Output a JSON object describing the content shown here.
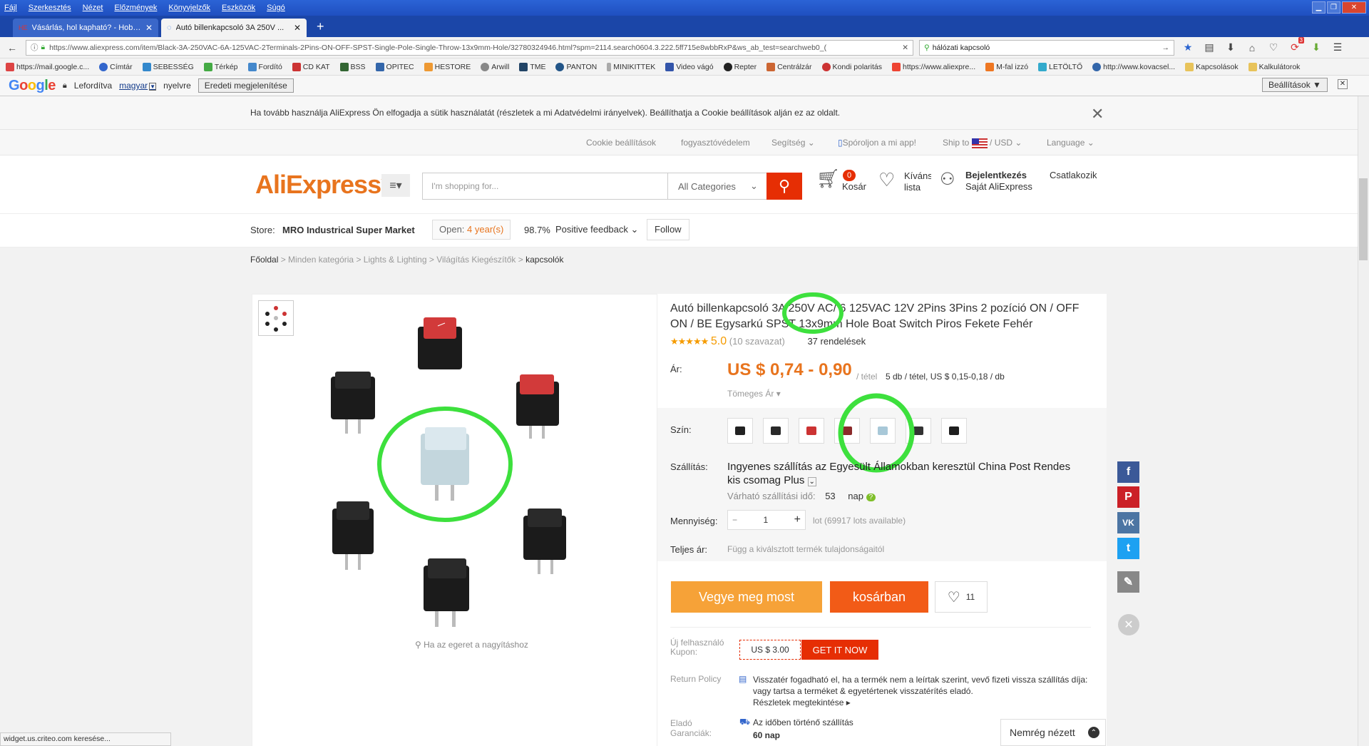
{
  "browser": {
    "menu": [
      "Fájl",
      "Szerkesztés",
      "Nézet",
      "Előzmények",
      "Könyvjelzők",
      "Eszközök",
      "Súgó"
    ],
    "tabs": [
      {
        "title": "Vásárlás, hol kapható? - Hobb..."
      },
      {
        "title": "Autó billenkapcsoló 3A 250V ..."
      }
    ],
    "url": "https://www.aliexpress.com/item/Black-3A-250VAC-6A-125VAC-2Terminals-2Pins-ON-OFF-SPST-Single-Pole-Single-Throw-13x9mm-Hole/32780324946.html?spm=2114.search0604.3.222.5ff715e8wbbRxP&ws_ab_test=searchweb0_(",
    "search_value": "hálózati kapcsoló",
    "notification_count": "3",
    "bookmarks": [
      "https://mail.google.c...",
      "Címtár",
      "SEBESSÉG",
      "Térkép",
      "Fordító",
      "CD KAT",
      "BSS",
      "OPITEC",
      "HESTORE",
      "Arwill",
      "TME",
      "PANTON",
      "MINIKITTEK",
      "Video vágó",
      "Repter",
      "Centrálzár",
      "Kondi polaritás",
      "https://www.aliexpre...",
      "M-fal izzó",
      "LETÖLTŐ",
      "http://www.kovacsel...",
      "Kapcsolások",
      "Kalkulátorok"
    ],
    "translate": {
      "logo": "Google",
      "translated": "Lefordítva",
      "language": "magyar",
      "suffix": "nyelvre",
      "show_original": "Eredeti megjelenítése",
      "settings": "Beállítások ▼"
    },
    "status": "widget.us.criteo.com keresése..."
  },
  "page": {
    "cookie_notice": "Ha tovább használja AliExpress Ön elfogadja a sütik használatát (részletek a mi Adatvédelmi irányelvek). Beállíthatja a Cookie beállítások alján ez az oldalt.",
    "topnav": {
      "cookie_settings": "Cookie beállítások",
      "consumer": "fogyasztóvédelem",
      "help": "Segítség",
      "app": "Spóroljon a mi app!",
      "ship_to": "Ship to",
      "currency": "USD",
      "language": "Language"
    },
    "header": {
      "logo": "AliExpress",
      "search_placeholder": "I'm shopping for...",
      "all_categories": "All Categories",
      "cart_count": "0",
      "cart_label": "Kosár",
      "wish_label": "Kívánság lista",
      "wish_line1": "Kívánság",
      "wish_line2": "lista",
      "login": "Bejelentkezés",
      "my_ali": "Saját AliExpress",
      "join": "Csatlakozik"
    },
    "store": {
      "label": "Store:",
      "name": "MRO Industrical Super Market",
      "open_label": "Open:",
      "open_years": "4 year(s)",
      "feedback_pct": "98.7%",
      "feedback_label": "Positive feedback",
      "follow": "Follow"
    },
    "breadcrumb": [
      "Főoldal",
      "Minden kategória",
      "Lights & Lighting",
      "Világítás Kiegészítők",
      "kapcsolók"
    ],
    "gallery": {
      "zoom_hint": "Ha az egeret a nagyításhoz"
    },
    "product": {
      "title": "Autó billenkapcsoló 3A 250V AC/ 6 125VAC 12V 2Pins 3Pins 2 pozíció ON / OFF ON / BE Egysarkú SPST 13x9mm Hole Boat Switch Piros Fekete Fehér",
      "rating": "5.0",
      "rating_value": 5.0,
      "reviews": "(10 szavazat)",
      "orders": "37 rendelések",
      "price_label": "Ár:",
      "price": "US $ 0,74 - 0,90",
      "price_unit": "/ tétel",
      "lot_info": "5 db / tétel, US $ 0,15-0,18 / db",
      "bulk": "Tömeges Ár",
      "color_label": "Szín:",
      "colors": [
        {
          "name": "black",
          "color": "#222"
        },
        {
          "name": "black",
          "color": "#2a2a2a"
        },
        {
          "name": "red",
          "color": "#cc3333"
        },
        {
          "name": "red-black",
          "color": "#8b2a2a"
        },
        {
          "name": "white",
          "color": "#a8c8d8"
        },
        {
          "name": "black",
          "color": "#333"
        },
        {
          "name": "black",
          "color": "#1e1e1e"
        }
      ],
      "shipping_label": "Szállítás:",
      "shipping_text": "Ingyenes szállítás az Egyesült Államokban keresztül China Post Rendes kis csomag Plus",
      "delivery_label": "Várható szállítási idő:",
      "delivery_days": "53",
      "delivery_unit": "nap",
      "qty_label": "Mennyiség:",
      "qty_value": "1",
      "qty_available": "lot (69917 lots available)",
      "total_label": "Teljes ár:",
      "total_text": "Függ a kiválsztott termék tulajdonságaitól",
      "buy_now": "Vegye meg most",
      "add_cart": "kosárban",
      "wish_count": "11",
      "coupon_label": "Új felhasználó Kupon:",
      "coupon_amount": "US $ 3.00",
      "coupon_btn": "GET IT NOW",
      "return_label": "Return Policy",
      "return_text": "Visszatér fogadható el, ha a termék nem a leírtak szerint, vevő fizeti vissza szállítás díja: vagy tartsa a terméket & egyetértenek visszatérítés eladó.",
      "return_more": "Részletek megtekintése",
      "guarantee_label": "Eladó Garanciák:",
      "guarantee_text": "Az időben történő szállítás",
      "guarantee_days": "60 nap"
    },
    "recent": "Nemrég nézett"
  }
}
